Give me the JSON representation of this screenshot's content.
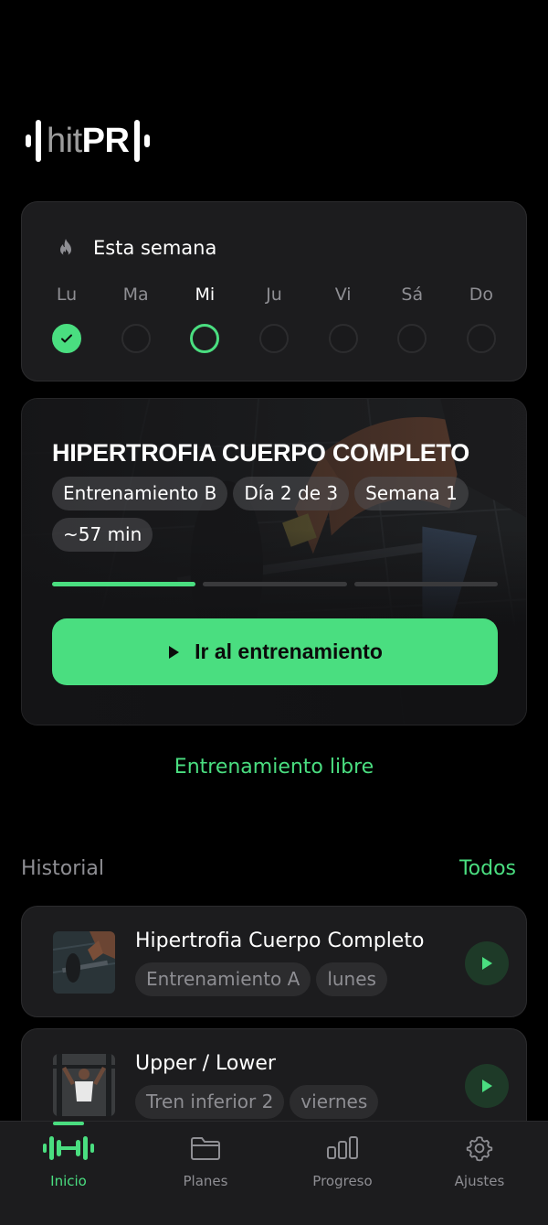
{
  "app": {
    "logo_hit": "hit",
    "logo_pr": "PR",
    "accent_color": "#4ade80"
  },
  "week": {
    "title": "Esta semana",
    "icon": "flame-icon",
    "days": [
      {
        "label": "Lu",
        "state": "done"
      },
      {
        "label": "Ma",
        "state": "empty"
      },
      {
        "label": "Mi",
        "state": "current"
      },
      {
        "label": "Ju",
        "state": "empty"
      },
      {
        "label": "Vi",
        "state": "empty"
      },
      {
        "label": "Sá",
        "state": "empty"
      },
      {
        "label": "Do",
        "state": "empty"
      }
    ]
  },
  "workout": {
    "title": "HIPERTROFIA CUERPO COMPLETO",
    "chips": [
      "Entrenamiento B",
      "Día 2 de 3",
      "Semana 1",
      "~57 min"
    ],
    "progress_segments": [
      true,
      false,
      false
    ],
    "button_label": "Ir al entrenamiento"
  },
  "free_workout_label": "Entrenamiento libre",
  "history": {
    "title": "Historial",
    "all_label": "Todos",
    "items": [
      {
        "name": "Hipertrofia Cuerpo Completo",
        "tags": [
          "Entrenamiento A",
          "lunes"
        ]
      },
      {
        "name": "Upper / Lower",
        "tags": [
          "Tren inferior 2",
          "viernes"
        ]
      }
    ]
  },
  "tabs": [
    {
      "label": "Inicio",
      "icon": "dumbbell-icon",
      "active": true
    },
    {
      "label": "Planes",
      "icon": "folder-icon",
      "active": false
    },
    {
      "label": "Progreso",
      "icon": "bar-chart-icon",
      "active": false
    },
    {
      "label": "Ajustes",
      "icon": "gear-icon",
      "active": false
    }
  ]
}
